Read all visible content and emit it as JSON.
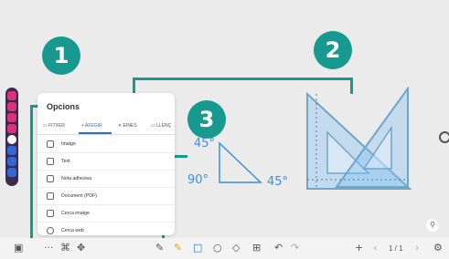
{
  "badges": {
    "one": "1",
    "two": "2",
    "three": "3"
  },
  "panel": {
    "title": "Opcions",
    "tabs": [
      "FITXER",
      "AFEGIR",
      "EINES",
      "LLENÇ"
    ],
    "items": [
      "Imatge",
      "Text",
      "Nota adhesiva",
      "Document (PDF)",
      "Cerca imatge",
      "Cerca web"
    ]
  },
  "canvas": {
    "angle_top": "45°",
    "angle_left": "90°",
    "angle_right": "45°"
  },
  "toolbar": {
    "more": "···",
    "page": "1 / 1",
    "add": "+"
  },
  "colors": {
    "accent": "#17998f",
    "handwriting": "#3b8ee8",
    "sidebar": "#3b2b4d"
  }
}
